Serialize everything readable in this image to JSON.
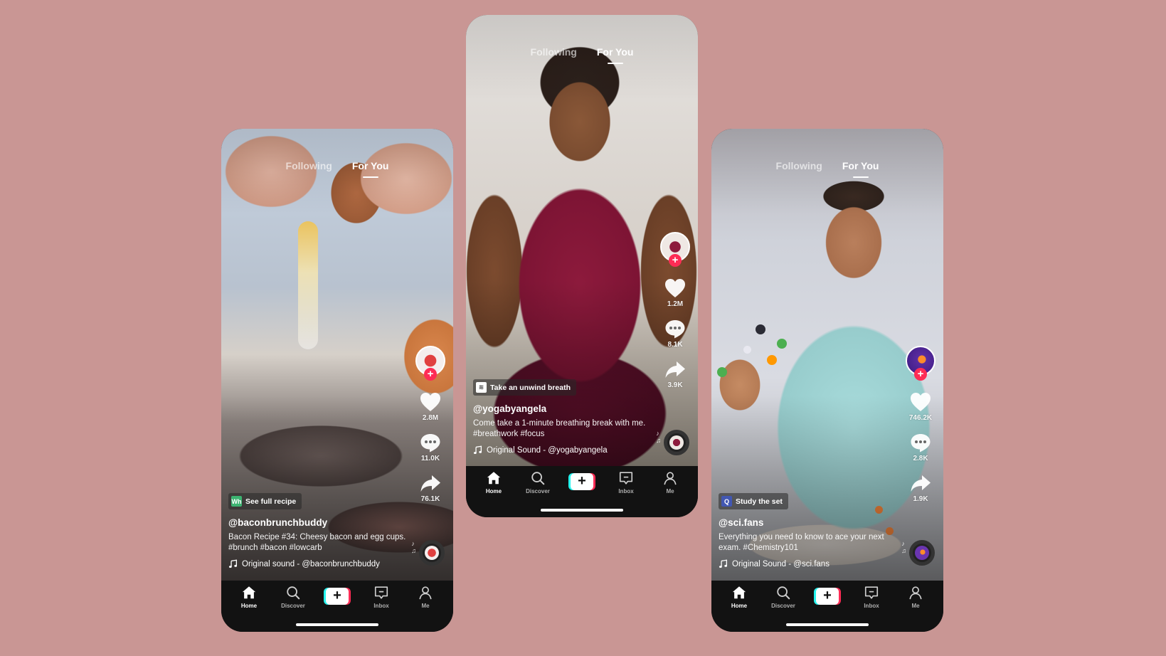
{
  "theme": {
    "background": "#c99694",
    "follow_badge": "#fe2c55",
    "create_cyan": "#25f4ee",
    "create_red": "#fe2c55",
    "nav_bg": "#121212"
  },
  "tabs": {
    "following": "Following",
    "for_you": "For You",
    "active": "For You"
  },
  "nav": {
    "home": "Home",
    "discover": "Discover",
    "create": "+",
    "inbox": "Inbox",
    "me": "Me",
    "active": "Home"
  },
  "phones": [
    {
      "id": "left",
      "likes": "2.8M",
      "comments": "11.0K",
      "shares": "76.1K",
      "chip": {
        "icon": "whisk-app-icon",
        "icon_text": "Wh",
        "icon_color": "#3cb371",
        "label": "See full recipe"
      },
      "handle": "@baconbrunchbuddy",
      "description": "Bacon Recipe #34: Cheesy bacon and egg cups. #brunch #bacon #lowcarb",
      "sound": "Original sound - @baconbrunchbuddy"
    },
    {
      "id": "middle",
      "likes": "1.2M",
      "comments": "8.1K",
      "shares": "3.9K",
      "chip": {
        "icon": "breathe-icon",
        "icon_text": "≋",
        "icon_color": "#ffffff",
        "label": "Take an unwind breath"
      },
      "handle": "@yogabyangela",
      "description": "Come take a 1-minute breathing break with me. #breathwork #focus",
      "sound": "Original Sound - @yogabyangela"
    },
    {
      "id": "right",
      "likes": "746.2K",
      "comments": "2.8K",
      "shares": "1.9K",
      "chip": {
        "icon": "quizlet-icon",
        "icon_text": "Q",
        "icon_color": "#4257b2",
        "label": "Study the set"
      },
      "handle": "@sci.fans",
      "description": "Everything you need to know to ace your next exam. #Chemistry101",
      "sound": "Original Sound - @sci.fans"
    }
  ]
}
